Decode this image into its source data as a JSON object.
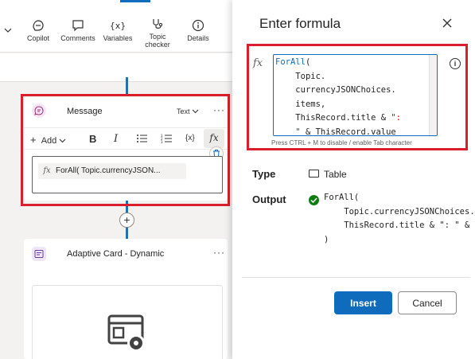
{
  "toolbar": {
    "items": [
      {
        "label": "Copilot",
        "icon": "copilot-icon"
      },
      {
        "label": "Comments",
        "icon": "comment-icon"
      },
      {
        "label": "Variables",
        "icon": "variables-icon"
      },
      {
        "label": "Topic checker",
        "icon": "stethoscope-icon"
      },
      {
        "label": "Details",
        "icon": "info-icon"
      }
    ]
  },
  "message_node": {
    "title": "Message",
    "type_selector": "Text",
    "more": "···",
    "format_toolbar": {
      "add_label": "Add",
      "bold": "B",
      "italic": "I",
      "bullet_list": "☰",
      "numbered_list": "☰",
      "variable": "{x}",
      "formula": "fx"
    },
    "formula_pill": "ForAll( Topic.currencyJSON..."
  },
  "adaptive_card_node": {
    "title": "Adaptive Card - Dynamic",
    "more": "···"
  },
  "formula_panel": {
    "title": "Enter formula",
    "fx_label": "fx",
    "hint": "Press CTRL + M to disable / enable Tab character",
    "type_label": "Type",
    "type_value": "Table",
    "output_label": "Output",
    "output_lines": [
      "ForAll(",
      "    Topic.currencyJSONChoices.items,",
      "    ThisRecord.title & \": \" & ThisRecord.value",
      ")"
    ],
    "insert_label": "Insert",
    "cancel_label": "Cancel"
  },
  "colors": {
    "primary": "#0f6cbd",
    "highlight_border": "#d91f2d",
    "success": "#107c10"
  }
}
